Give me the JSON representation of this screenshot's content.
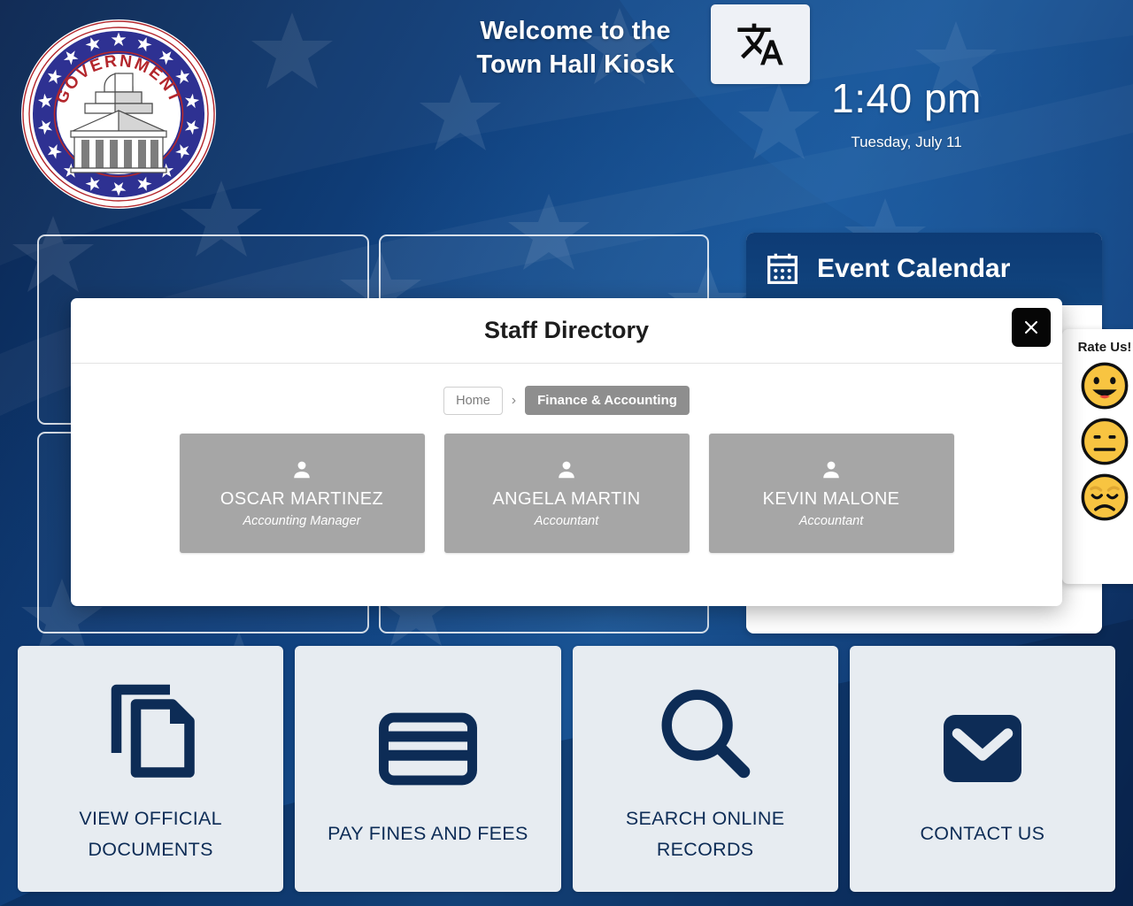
{
  "header": {
    "welcome_title": "Welcome to the\nTown Hall Kiosk",
    "welcome_line1": "Welcome to the",
    "welcome_line2": "Town Hall Kiosk",
    "translate_icon": "translate-icon",
    "seal_text": "GOVERNMENT",
    "clock_time": "1:40 pm",
    "clock_date": "Tuesday, July 11"
  },
  "event_panel": {
    "title": "Event Calendar",
    "icon": "calendar-icon"
  },
  "rate_panel": {
    "title": "Rate Us!",
    "faces": [
      {
        "name": "happy-face-icon",
        "mood": "happy"
      },
      {
        "name": "neutral-face-icon",
        "mood": "neutral"
      },
      {
        "name": "sad-face-icon",
        "mood": "sad"
      }
    ]
  },
  "modal": {
    "title": "Staff Directory",
    "close_label": "✕",
    "breadcrumb": {
      "home_label": "Home",
      "separator": "›",
      "current_label": "Finance & Accounting"
    },
    "staff": [
      {
        "name": "OSCAR MARTINEZ",
        "role": "Accounting Manager",
        "avatar": "person-icon"
      },
      {
        "name": "ANGELA MARTIN",
        "role": "Accountant",
        "avatar": "person-icon"
      },
      {
        "name": "KEVIN MALONE",
        "role": "Accountant",
        "avatar": "person-icon"
      }
    ]
  },
  "bottom_nav": [
    {
      "label": "VIEW OFFICIAL DOCUMENTS",
      "icon": "documents-copy-icon"
    },
    {
      "label": "PAY FINES AND FEES",
      "icon": "credit-card-icon"
    },
    {
      "label": "SEARCH ONLINE RECORDS",
      "icon": "magnifier-icon"
    },
    {
      "label": "CONTACT US",
      "icon": "envelope-icon"
    }
  ],
  "colors": {
    "background_dark_blue": "#0a2550",
    "background_mid_blue": "#1a5596",
    "tile_background": "#e7ecf1",
    "tile_icon_navy": "#0d2c56",
    "staff_card_gray": "#a6a6a6",
    "breadcrumb_active_gray": "#8e8e8e",
    "close_button_black": "#060606",
    "event_header_navy": "#0d3b75",
    "accent_red": "#8b1a1a",
    "emoji_yellow": "#f8c441"
  }
}
